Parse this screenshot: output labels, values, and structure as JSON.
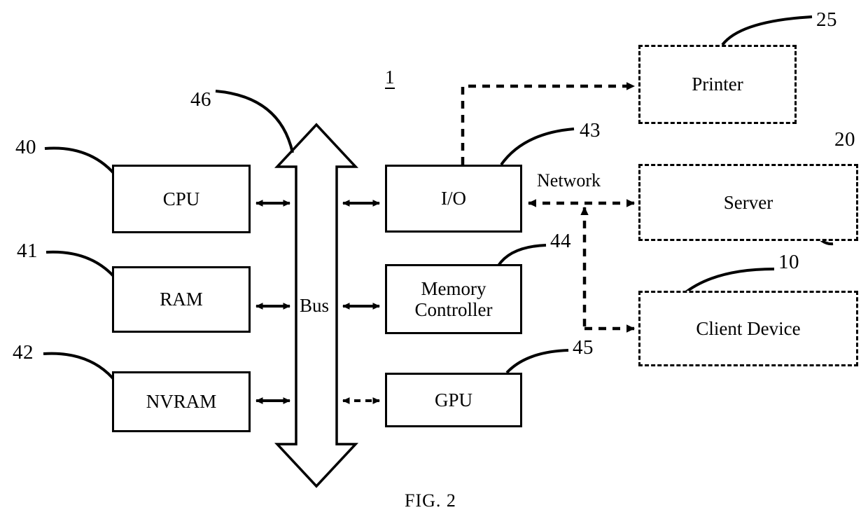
{
  "figure": {
    "caption": "FIG. 2",
    "system_ref": "1"
  },
  "nodes": {
    "cpu": {
      "label": "CPU",
      "ref": "40",
      "style": "solid"
    },
    "ram": {
      "label": "RAM",
      "ref": "41",
      "style": "solid"
    },
    "nvram": {
      "label": "NVRAM",
      "ref": "42",
      "style": "solid"
    },
    "io": {
      "label": "I/O",
      "ref": "43",
      "style": "solid"
    },
    "memctrl": {
      "label": "Memory\nController",
      "ref": "44",
      "style": "solid"
    },
    "gpu": {
      "label": "GPU",
      "ref": "45",
      "style": "solid"
    },
    "bus": {
      "label": "Bus",
      "ref": "46",
      "style": "arrow"
    },
    "printer": {
      "label": "Printer",
      "ref": "25",
      "style": "dashed"
    },
    "server": {
      "label": "Server",
      "ref": "20",
      "style": "dashed"
    },
    "client": {
      "label": "Client Device",
      "ref": "10",
      "style": "dashed"
    }
  },
  "edges": {
    "network_label": "Network"
  },
  "colors": {
    "stroke": "#000000",
    "fill": "#ffffff",
    "text": "#000000"
  }
}
